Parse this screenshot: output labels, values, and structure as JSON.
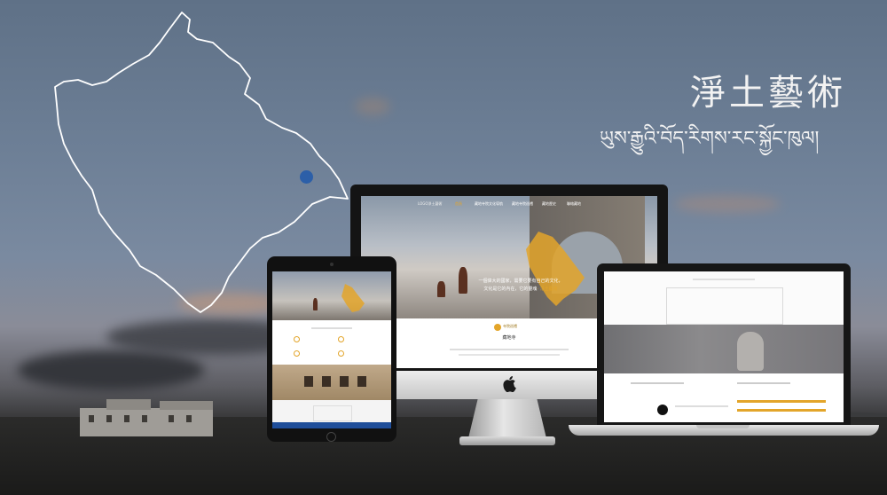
{
  "banner": {
    "title_chinese": "淨土藝術",
    "title_tibetan": "ཡུས་རྒྱུའི་བོད་རིགས་རང་སྐྱོང་ཁུལ།",
    "colors": {
      "accent_gold": "#e3a52a",
      "marker_blue": "#2c5fa8"
    }
  },
  "monitor": {
    "brand_icon": "apple-logo-icon",
    "nav": {
      "logo": "LOGO淨土藝術",
      "items": [
        "首頁",
        "藏地寺院文化導航",
        "藏地寺院巡禮",
        "藏地歷史",
        "聯絡藏地"
      ]
    },
    "hero_text_line1": "一個偉大的國家，需要它要有自己的文化，",
    "hero_text_line2": "文化是它的內在，它的靈魂",
    "hero_text_link": "· 淨土藝術",
    "section_label": "寺院巡禮",
    "section_heading": "藏地寺"
  }
}
